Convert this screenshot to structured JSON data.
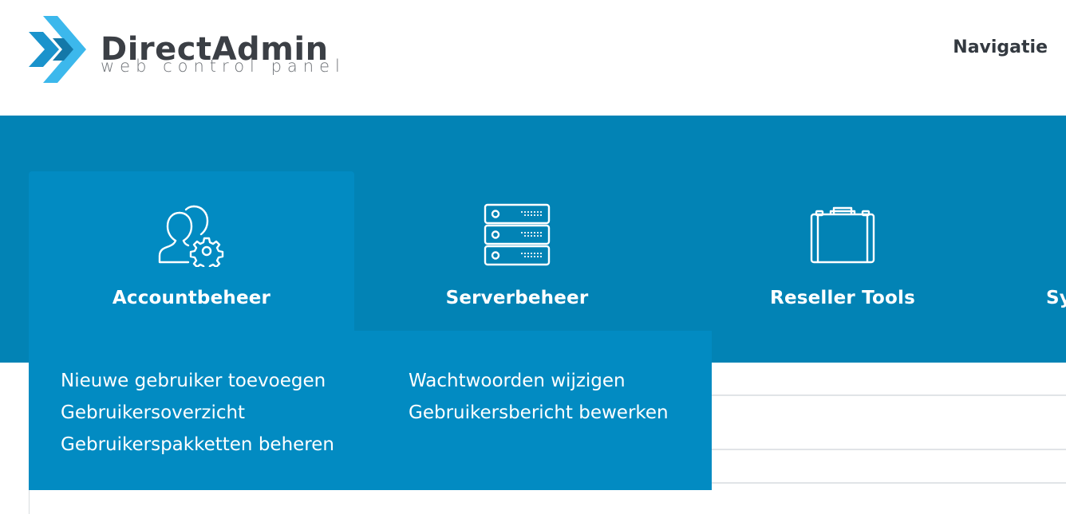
{
  "brand": {
    "name": "DirectAdmin",
    "tagline": "web control panel",
    "colors": {
      "primary_blue": "#0283b5",
      "tile_blue": "#028bc2",
      "logo_light": "#3cb8ec",
      "logo_dark": "#1a93cc",
      "text_dark": "#333940"
    }
  },
  "header": {
    "nav_label": "Navigatie"
  },
  "menu": {
    "tiles": [
      {
        "label": "Accountbeheer",
        "icon": "users-gear-icon",
        "active": true
      },
      {
        "label": "Serverbeheer",
        "icon": "server-icon",
        "active": false
      },
      {
        "label": "Reseller Tools",
        "icon": "briefcase-icon",
        "active": false
      },
      {
        "label": "Sy",
        "icon": "",
        "active": false
      }
    ],
    "dropdown": {
      "col1": [
        "Nieuwe gebruiker toevoegen",
        "Gebruikersoverzicht",
        "Gebruikerspakketten beheren"
      ],
      "col2": [
        "Wachtwoorden wijzigen",
        "Gebruikersbericht bewerken"
      ]
    }
  }
}
